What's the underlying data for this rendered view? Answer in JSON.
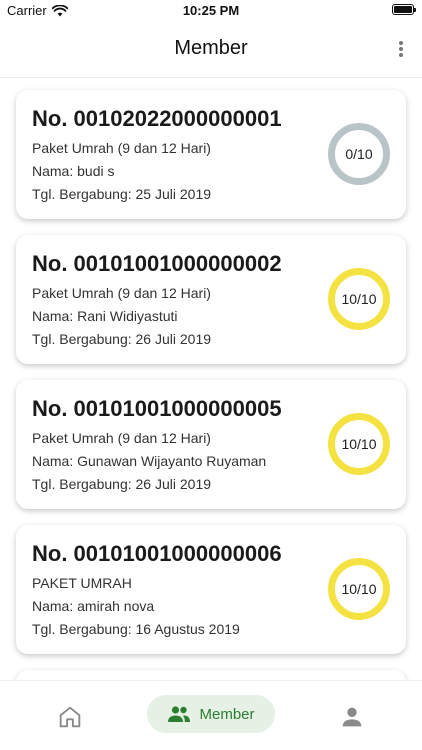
{
  "status_bar": {
    "carrier": "Carrier",
    "time": "10:25 PM",
    "icons": [
      "wifi-icon",
      "battery-icon"
    ]
  },
  "header": {
    "title": "Member",
    "menu_icon": "more-vertical-icon"
  },
  "members": [
    {
      "number": "No. 00102022000000001",
      "package": "Paket Umrah (9 dan 12 Hari)",
      "name": "Nama: budi s",
      "joined": "Tgl. Bergabung: 25 Juli 2019",
      "progress_label": "0/10",
      "progress_value": 0,
      "progress_max": 10,
      "ring_color": "#b9c4c9"
    },
    {
      "number": "No. 00101001000000002",
      "package": "Paket Umrah (9 dan 12 Hari)",
      "name": "Nama: Rani Widiyastuti",
      "joined": "Tgl. Bergabung: 26 Juli 2019",
      "progress_label": "10/10",
      "progress_value": 10,
      "progress_max": 10,
      "ring_color": "#f4e242"
    },
    {
      "number": "No. 00101001000000005",
      "package": "Paket Umrah (9 dan 12 Hari)",
      "name": "Nama: Gunawan Wijayanto Ruyaman",
      "joined": "Tgl. Bergabung: 26 Juli 2019",
      "progress_label": "10/10",
      "progress_value": 10,
      "progress_max": 10,
      "ring_color": "#f4e242"
    },
    {
      "number": "No. 00101001000000006",
      "package": "PAKET UMRAH",
      "name": "Nama: amirah nova",
      "joined": "Tgl. Bergabung: 16 Agustus 2019",
      "progress_label": "10/10",
      "progress_value": 10,
      "progress_max": 10,
      "ring_color": "#f4e242"
    }
  ],
  "bottom_nav": {
    "items": [
      {
        "id": "home",
        "icon": "home-icon",
        "label": "",
        "active": false
      },
      {
        "id": "member",
        "icon": "people-icon",
        "label": "Member",
        "active": true
      },
      {
        "id": "profile",
        "icon": "person-icon",
        "label": "",
        "active": false
      }
    ],
    "active_color": "#2d7d32",
    "active_bg": "#e4f1e4",
    "inactive_color": "#8a8a8a"
  }
}
